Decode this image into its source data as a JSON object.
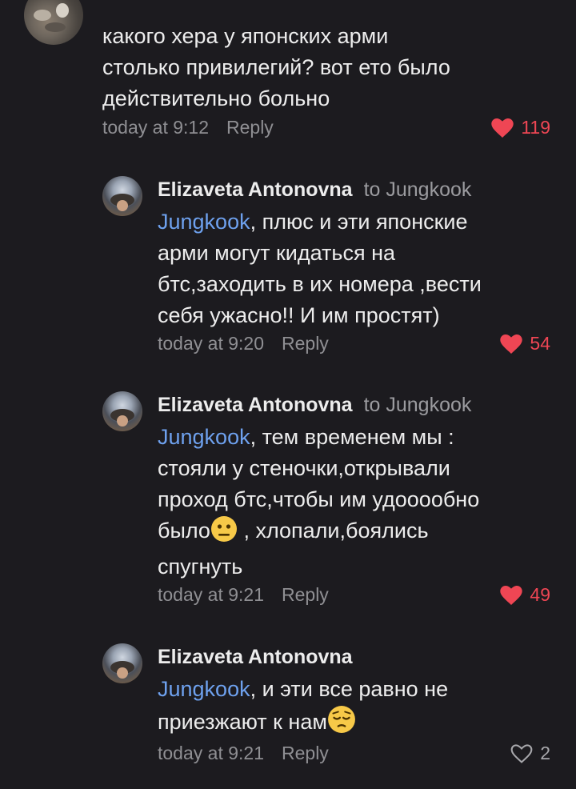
{
  "comments": [
    {
      "lines": [
        "какого хера у японских арми",
        "столько привилегий? вот ето было",
        "действительно больно"
      ],
      "time": "today at 9:12",
      "reply_label": "Reply",
      "likes": "119",
      "liked": true
    },
    {
      "author": "Elizaveta Antonovna",
      "to": "to Jungkook",
      "mention": "Jungkook",
      "first_line_rest": ", плюс и эти японские",
      "lines": [
        "арми могут кидаться на",
        "бтс,заходить в их номера ,вести",
        "себя ужасно!! И им простят)"
      ],
      "time": "today at 9:20",
      "reply_label": "Reply",
      "likes": "54",
      "liked": true
    },
    {
      "author": "Elizaveta Antonovna",
      "to": "to Jungkook",
      "mention": "Jungkook",
      "first_line_rest": ", тем временем мы :",
      "line2": "стояли у стеночки,открывали",
      "line3": "проход бтс,чтобы им удооообно",
      "line4_a": "было",
      "line4_b": " , хлопали,боялись",
      "line5": "спугнуть",
      "emoji": "neutral-face-emoji",
      "time": "today at 9:21",
      "reply_label": "Reply",
      "likes": "49",
      "liked": true
    },
    {
      "author": "Elizaveta Antonovna",
      "mention": "Jungkook",
      "first_line_rest": ", и эти все равно  не",
      "line2": "приезжают к нам",
      "emoji": "pensive-face-emoji",
      "time": "today at 9:21",
      "reply_label": "Reply",
      "likes": "2",
      "liked": false
    }
  ],
  "colors": {
    "background": "#1c1b1f",
    "mention": "#6ea1ee",
    "like_active": "#ef4654",
    "like_inactive": "#a8a8ac"
  }
}
